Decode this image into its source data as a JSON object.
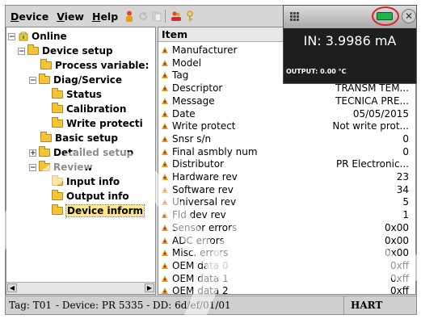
{
  "menu": {
    "device_u": "D",
    "device_rest": "evice",
    "view_u": "V",
    "view_rest": "iew",
    "help_u": "H",
    "help_rest": "elp"
  },
  "toolbar_icons": [
    "person-icon",
    "refresh-icon",
    "copy-icon",
    "users-icon",
    "key-icon"
  ],
  "tree": {
    "root": "Online",
    "device_setup": "Device setup",
    "process_variables": "Process variable:",
    "diag_service": "Diag/Service",
    "status": "Status",
    "calibration": "Calibration",
    "write_protection": "Write protecti",
    "basic_setup": "Basic setup",
    "detailed_setup": "Detailed setup",
    "review": "Review",
    "input_info": "Input info",
    "output_info": "Output info",
    "device_information": "Device inform"
  },
  "grid": {
    "header": "Item",
    "rows": [
      {
        "label": "Manufacturer",
        "value": ""
      },
      {
        "label": "Model",
        "value": ""
      },
      {
        "label": "Tag",
        "value": ""
      },
      {
        "label": "Descriptor",
        "value": "TRANSM TEM..."
      },
      {
        "label": "Message",
        "value": "TECNICA PRE..."
      },
      {
        "label": "Date",
        "value": "05/05/2015"
      },
      {
        "label": "Write protect",
        "value": "Not write prot..."
      },
      {
        "label": "Snsr s/n",
        "value": "0"
      },
      {
        "label": "Final asmbly num",
        "value": "0"
      },
      {
        "label": "Distributor",
        "value": "PR Electronic..."
      },
      {
        "label": "Hardware rev",
        "value": "23"
      },
      {
        "label": "Software rev",
        "value": "34"
      },
      {
        "label": "Universal rev",
        "value": "5"
      },
      {
        "label": "Fld dev rev",
        "value": "1"
      },
      {
        "label": "Sensor errors",
        "value": "0x00"
      },
      {
        "label": "ADC errors",
        "value": "0x00"
      },
      {
        "label": "Misc. errors",
        "value": "0x00"
      },
      {
        "label": "OEM data 0",
        "value": "0xff"
      },
      {
        "label": "OEM data 1",
        "value": "0xff"
      },
      {
        "label": "OEM data 2",
        "value": "0xff"
      }
    ]
  },
  "status": {
    "tag": "Tag: T01",
    "device": "- Device: PR 5335 - DD: 6d/ef/01/01",
    "protocol": "HART"
  },
  "popup": {
    "reading": "IN: 3.9986 mA",
    "output": "OUTPUT: 0.00 °C",
    "close": "✕"
  },
  "colors": {
    "folder": "#f3c43a",
    "battery": "#22b24c",
    "popup_bg": "#1e1e1e",
    "highlight_ring": "#dd2222"
  }
}
